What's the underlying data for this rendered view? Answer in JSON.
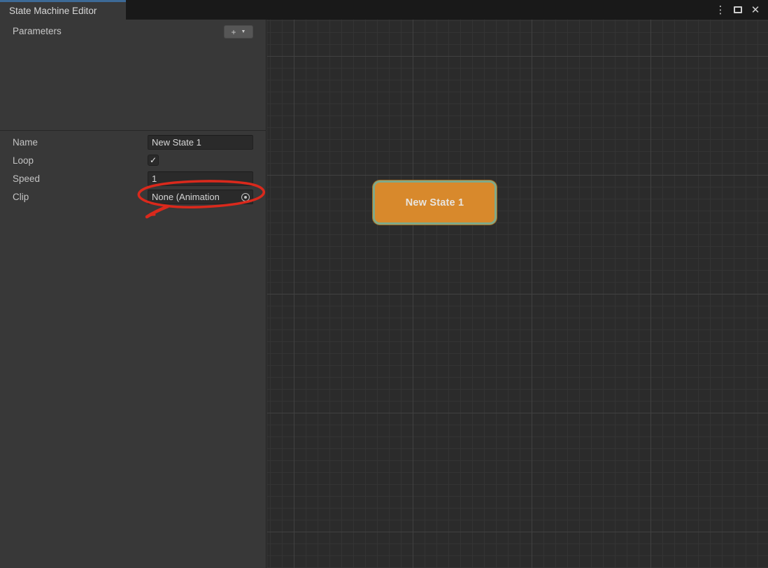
{
  "window": {
    "tab_title": "State Machine Editor",
    "controls": {
      "menu_glyph": "⋮",
      "close_glyph": "✕"
    }
  },
  "left_panel": {
    "parameters": {
      "label": "Parameters",
      "add_button": {
        "plus_glyph": "+",
        "dropdown_glyph": "▼"
      }
    },
    "inspector": {
      "name": {
        "label": "Name",
        "value": "New State 1"
      },
      "loop": {
        "label": "Loop",
        "checked": true,
        "check_glyph": "✓"
      },
      "speed": {
        "label": "Speed",
        "value": "1"
      },
      "clip": {
        "label": "Clip",
        "value": "None (Animation",
        "icon": "object-picker-icon"
      }
    }
  },
  "canvas": {
    "nodes": [
      {
        "label": "New State 1"
      }
    ]
  },
  "annotation": {
    "type": "hand-drawn-circle",
    "target": "clip-object-field",
    "color": "#da291c"
  },
  "colors": {
    "tab_accent_blue": "#3d6a96",
    "titlebar_bg": "#191919",
    "panel_bg": "#383838",
    "canvas_bg": "#2b2b2b",
    "node_fill": "#d8892c",
    "node_border": "#7fa98a",
    "annotation_red": "#da291c"
  }
}
